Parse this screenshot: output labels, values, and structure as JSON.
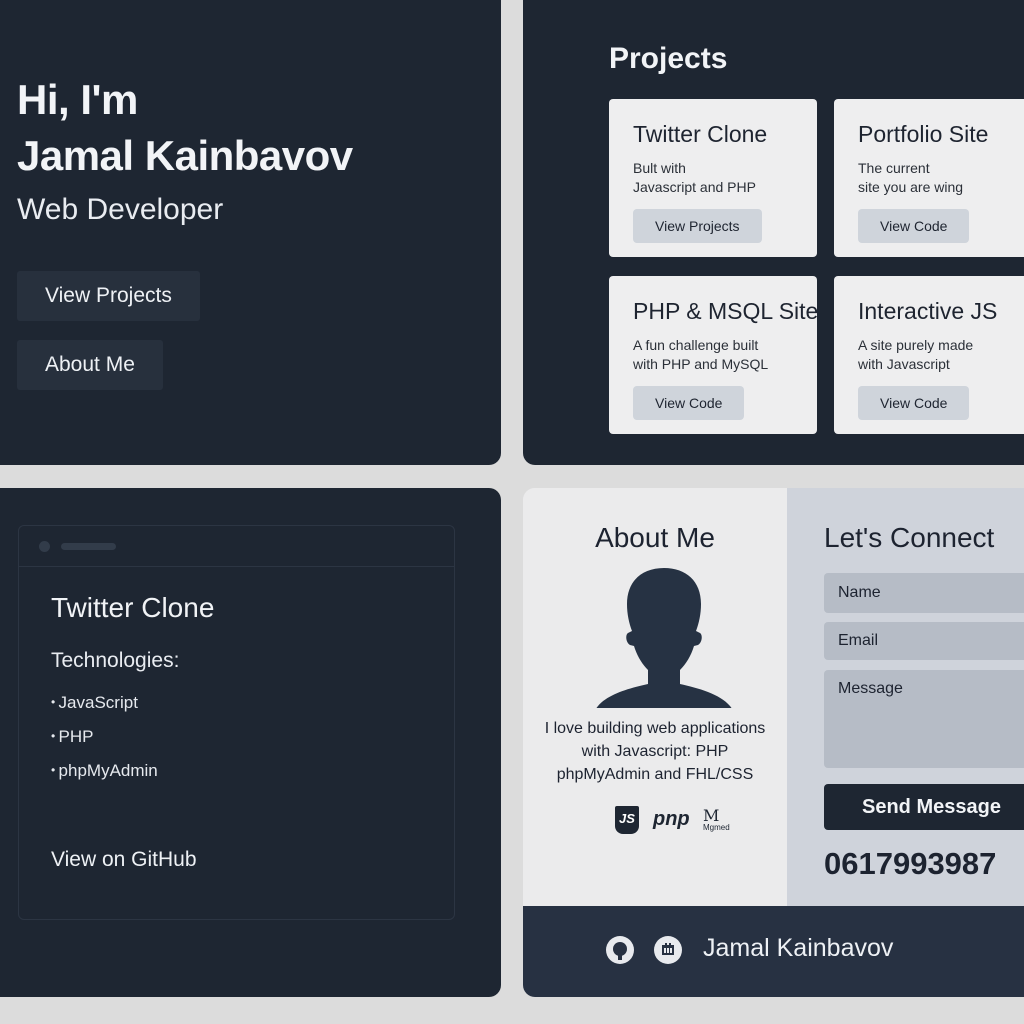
{
  "hero": {
    "greeting_line1": "Hi, I'm",
    "greeting_line2": "Jamal Kainbavov",
    "role": "Web Developer",
    "btn_projects": "View Projects",
    "btn_about": "About Me"
  },
  "projects": {
    "title": "Projects",
    "cards": [
      {
        "title": "Twitter Clone",
        "desc_line1": "Bult with",
        "desc_line2": "Javascript and PHP",
        "button": "View Projects"
      },
      {
        "title": "Portfolio Site",
        "desc_line1": "The current",
        "desc_line2": "site you are wing",
        "button": "View Code"
      },
      {
        "title": "PHP & MSQL Site",
        "desc_line1": "A fun challenge built",
        "desc_line2": "with PHP and MySQL",
        "button": "View Code"
      },
      {
        "title": "Interactive JS",
        "desc_line1": "A site purely made",
        "desc_line2": "with Javascript",
        "button": "View Code"
      }
    ]
  },
  "detail": {
    "title": "Twitter Clone",
    "tech_heading": "Technologies:",
    "technologies": [
      "JavaScript",
      "PHP",
      "phpMyAdmin"
    ],
    "github_link": "View on GitHub"
  },
  "about": {
    "title": "About Me",
    "text_line1": "I love building web applications",
    "text_line2": "with Javascript: PHP",
    "text_line3": "phpMyAdmin and FHL/CSS",
    "badge_js": "JS",
    "badge_pnp": "pnp",
    "badge_m": "M",
    "badge_m_caption": "Mgmed"
  },
  "contact": {
    "title": "Let's Connect",
    "name_placeholder": "Name",
    "email_placeholder": "Email",
    "message_placeholder": "Message",
    "send_button": "Send Message",
    "phone": "0617993987"
  },
  "footer": {
    "name": "Jamal Kainbavov"
  },
  "icons": [
    "github-icon",
    "linkedin-icon"
  ]
}
